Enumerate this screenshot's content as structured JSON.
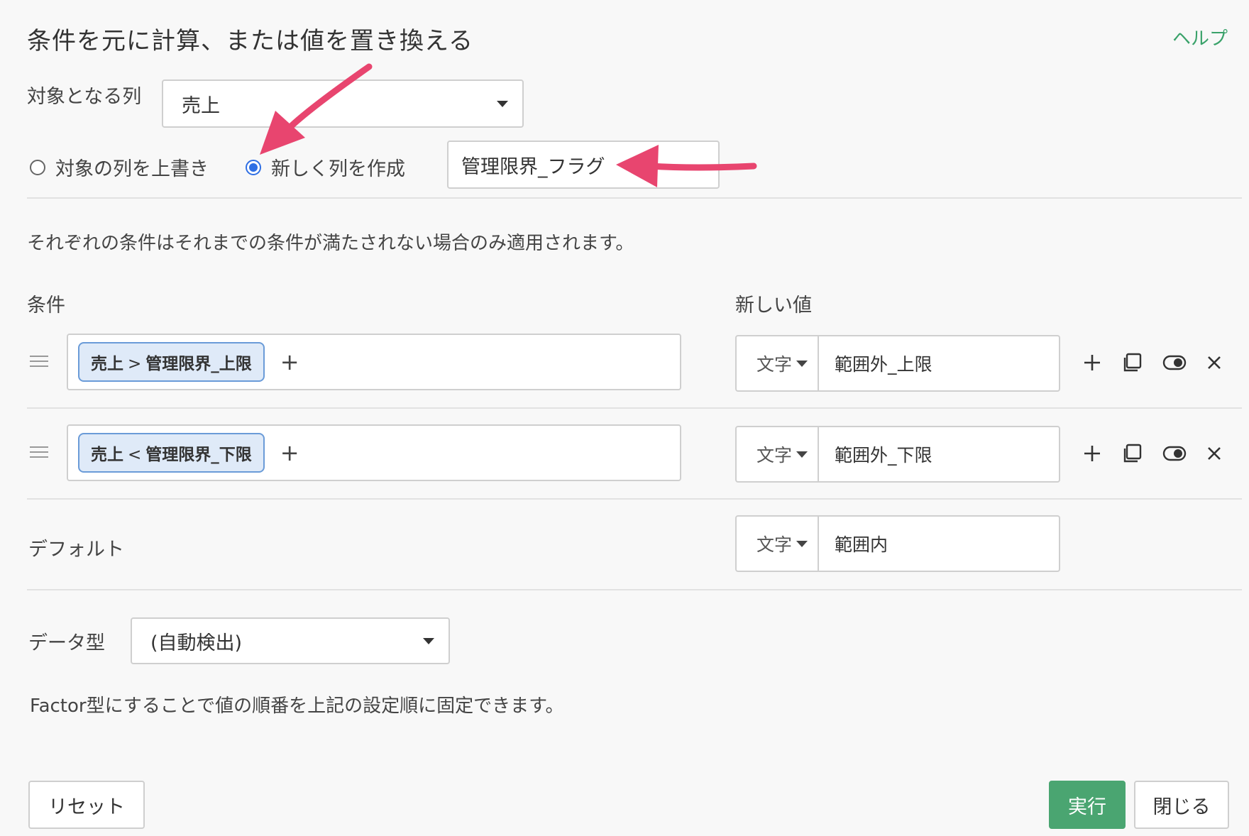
{
  "dialog": {
    "title": "条件を元に計算、または値を置き換える",
    "help_label": "ヘルプ"
  },
  "target_column": {
    "label": "対象となる列",
    "selected": "売上"
  },
  "output_mode": {
    "overwrite_label": "対象の列を上書き",
    "new_column_label": "新しく列を作成",
    "selected": "new_column",
    "new_column_name": "管理限界_フラグ"
  },
  "description": "それぞれの条件はそれまでの条件が満たされない場合のみ適用されます。",
  "headers": {
    "condition": "条件",
    "new_value": "新しい値"
  },
  "rules": [
    {
      "condition": {
        "left": "売上",
        "op": ">",
        "right": "管理限界_上限"
      },
      "value_type": "文字",
      "value": "範囲外_上限"
    },
    {
      "condition": {
        "left": "売上",
        "op": "<",
        "right": "管理限界_下限"
      },
      "value_type": "文字",
      "value": "範囲外_下限"
    }
  ],
  "default": {
    "label": "デフォルト",
    "value_type": "文字",
    "value": "範囲内"
  },
  "data_type": {
    "label": "データ型",
    "selected": "(自動検出)"
  },
  "factor_note": "Factor型にすることで値の順番を上記の設定順に固定できます。",
  "footer": {
    "reset_label": "リセット",
    "run_label": "実行",
    "close_label": "閉じる"
  },
  "colors": {
    "accent_green": "#4aa571",
    "radio_blue": "#2f6fe4",
    "chip_border": "#6a9bd8",
    "annotation_arrow": "#e8456f"
  },
  "icons": [
    "drag-handle-icon",
    "plus-icon",
    "copy-icon",
    "toggle-icon",
    "close-icon",
    "caret-down-icon"
  ]
}
